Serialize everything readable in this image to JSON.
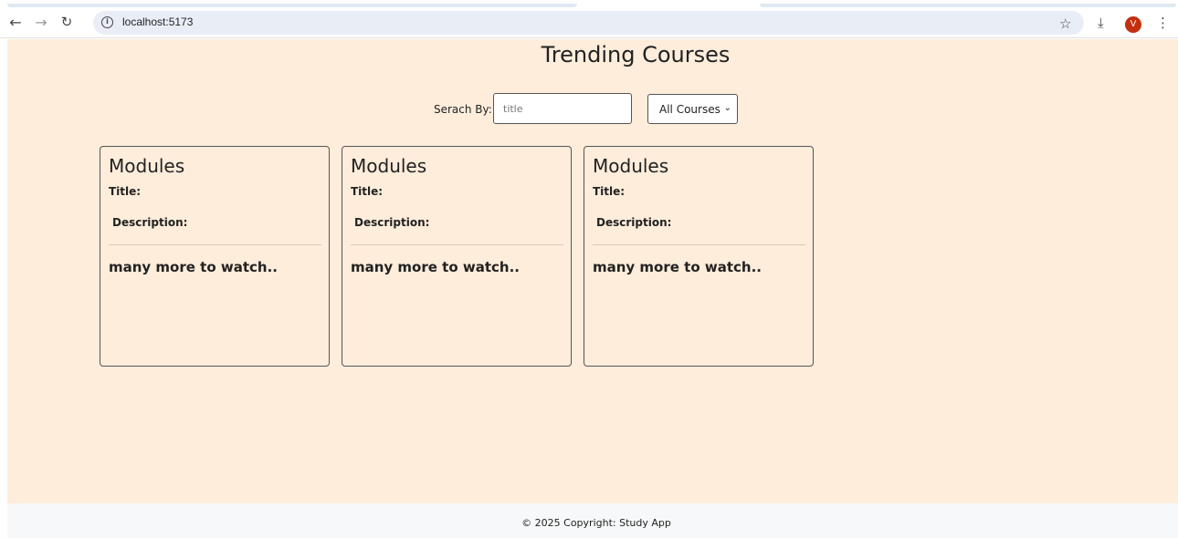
{
  "browser": {
    "url": "localhost:5173",
    "avatar_initial": "V",
    "icons": {
      "back": "arrow-left-icon",
      "forward": "arrow-right-icon",
      "reload": "reload-icon",
      "site_info": "info-icon",
      "bookmark": "star-icon",
      "downloads": "download-icon",
      "menu": "kebab-menu-icon"
    }
  },
  "page": {
    "title": "Trending Courses",
    "background_color": "#feeddb"
  },
  "search": {
    "label": "Serach By:",
    "placeholder": "title",
    "select_value": "All Courses"
  },
  "cards": [
    {
      "heading": "Modules",
      "title_label": "Title:",
      "description_label": "Description:",
      "more_text": "many more to watch.."
    },
    {
      "heading": "Modules",
      "title_label": "Title:",
      "description_label": "Description:",
      "more_text": "many more to watch.."
    },
    {
      "heading": "Modules",
      "title_label": "Title:",
      "description_label": "Description:",
      "more_text": "many more to watch.."
    }
  ],
  "footer": {
    "text": "© 2025 Copyright: Study App"
  }
}
